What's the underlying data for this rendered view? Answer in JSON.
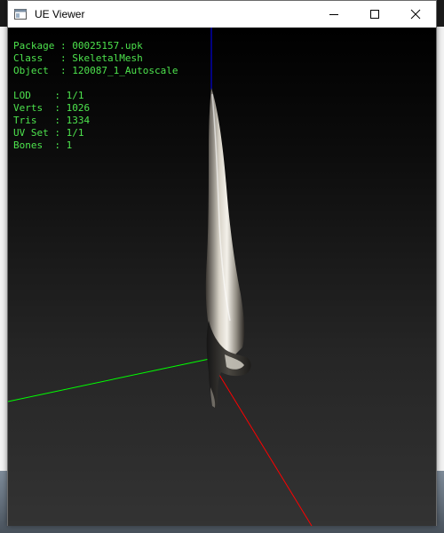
{
  "window": {
    "title": "UE Viewer",
    "controls": {
      "minimize": "minimize",
      "maximize": "maximize",
      "close": "close"
    }
  },
  "info_top": [
    {
      "label": "Package",
      "value": "00025157.upk"
    },
    {
      "label": "Class",
      "value": "SkeletalMesh"
    },
    {
      "label": "Object",
      "value": "120087_1_Autoscale"
    }
  ],
  "info_stats": [
    {
      "label": "LOD",
      "value": "1/1"
    },
    {
      "label": "Verts",
      "value": "1026"
    },
    {
      "label": "Tris",
      "value": "1334"
    },
    {
      "label": "UV Set",
      "value": "1/1"
    },
    {
      "label": "Bones",
      "value": "1"
    }
  ],
  "colors": {
    "info_text": "#4de34d",
    "axis_x": "#ff0000",
    "axis_y": "#00ff00",
    "axis_z": "#0000ff"
  }
}
